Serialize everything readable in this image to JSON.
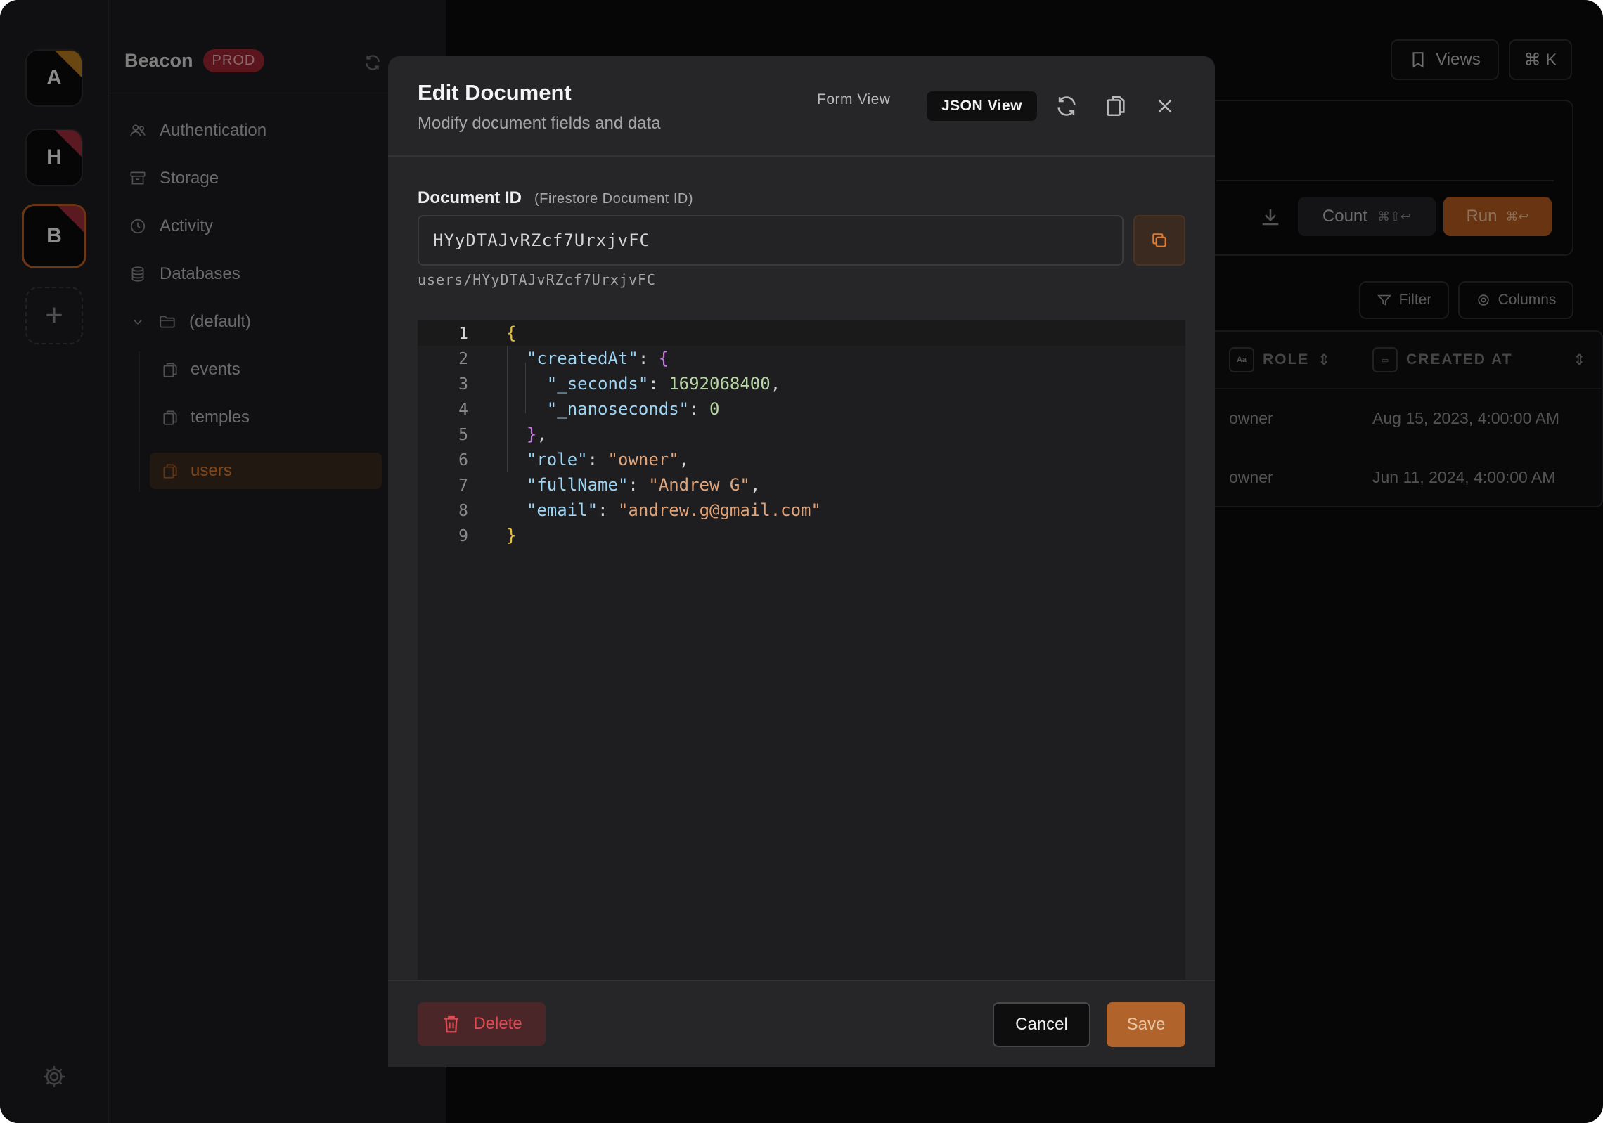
{
  "rail": {
    "workspaces": [
      {
        "letter": "A",
        "accent": "#b77a1f"
      },
      {
        "letter": "H",
        "accent": "#9e2b3c"
      },
      {
        "letter": "B",
        "accent": "#9e2b3c",
        "selected": true
      }
    ],
    "add_label": "+"
  },
  "sidebar": {
    "project_name": "Beacon",
    "env_badge": "PROD",
    "nav": [
      {
        "label": "Authentication",
        "icon": "users-icon"
      },
      {
        "label": "Storage",
        "icon": "archive-icon"
      },
      {
        "label": "Activity",
        "icon": "clock-icon"
      },
      {
        "label": "Databases",
        "icon": "database-icon"
      }
    ],
    "database": {
      "label": "(default)",
      "expanded": true
    },
    "collections": [
      {
        "label": "events"
      },
      {
        "label": "temples"
      },
      {
        "label": "users",
        "active": true
      }
    ]
  },
  "main": {
    "views_label": "Views",
    "shortcut_label": "⌘ K",
    "count_label": "Count",
    "count_shortcut": "⌘⇧↩",
    "run_label": "Run",
    "run_shortcut": "⌘↩",
    "filter_label": "Filter",
    "columns_label": "Columns",
    "table": {
      "columns": [
        {
          "label": "ROLE",
          "icon": "Aa"
        },
        {
          "label": "CREATED AT",
          "icon": "calendar-icon"
        }
      ],
      "rows": [
        {
          "role": "owner",
          "created_at": "Aug 15, 2023, 4:00:00 AM"
        },
        {
          "role": "owner",
          "created_at": "Jun 11, 2024, 4:00:00 AM"
        }
      ]
    }
  },
  "modal": {
    "title": "Edit Document",
    "subtitle": "Modify document fields and data",
    "form_view_label": "Form View",
    "json_view_label": "JSON View",
    "doc_id_label": "Document ID",
    "doc_id_hint": "(Firestore Document ID)",
    "doc_id_value": "HYyDTAJvRZcf7UrxjvFC",
    "doc_path": "users/HYyDTAJvRZcf7UrxjvFC",
    "json_lines": [
      "{",
      "  \"createdAt\": {",
      "    \"_seconds\": 1692068400,",
      "    \"_nanoseconds\": 0",
      "  },",
      "  \"role\": \"owner\",",
      "  \"fullName\": \"Andrew G\",",
      "  \"email\": \"andrew.g@gmail.com\"",
      "}"
    ],
    "delete_label": "Delete",
    "cancel_label": "Cancel",
    "save_label": "Save"
  },
  "colors": {
    "accent": "#e07a2c",
    "danger": "#e24a52",
    "prod_badge": "#9d2733"
  }
}
